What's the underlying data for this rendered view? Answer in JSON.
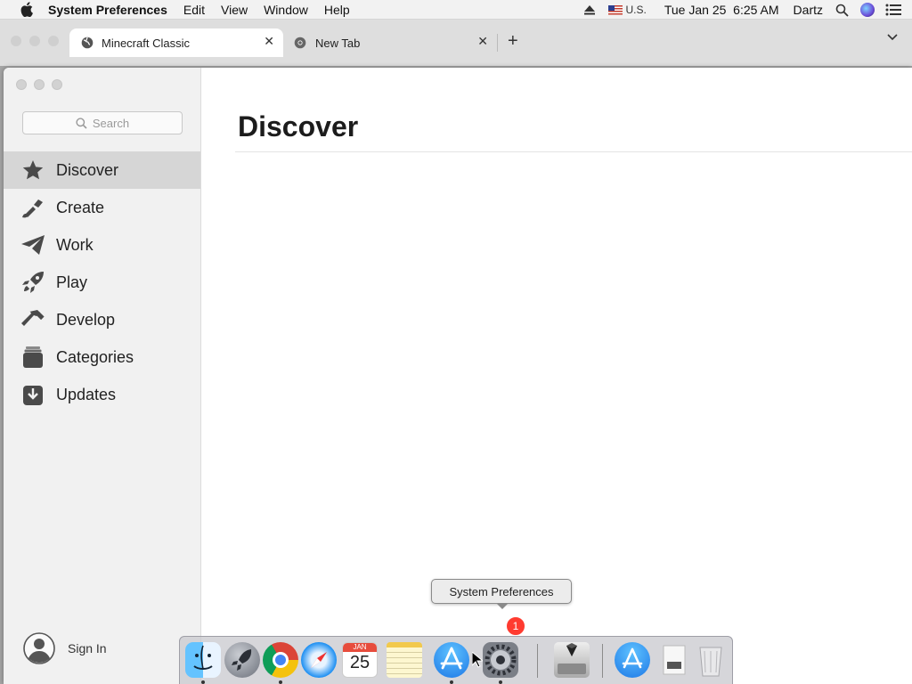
{
  "menubar": {
    "app_name": "System Preferences",
    "items": [
      "Edit",
      "View",
      "Window",
      "Help"
    ],
    "input_source": "U.S.",
    "datetime": "Tue Jan 25  6:25 AM",
    "user": "Dartz"
  },
  "browser": {
    "tabs": [
      {
        "title": "Minecraft Classic"
      },
      {
        "title": "New Tab"
      }
    ]
  },
  "sidebar": {
    "search_placeholder": "Search",
    "items": [
      {
        "label": "Discover",
        "icon": "star-icon"
      },
      {
        "label": "Create",
        "icon": "brush-icon"
      },
      {
        "label": "Work",
        "icon": "paper-plane-icon"
      },
      {
        "label": "Play",
        "icon": "rocket-icon"
      },
      {
        "label": "Develop",
        "icon": "hammer-icon"
      },
      {
        "label": "Categories",
        "icon": "stack-icon"
      },
      {
        "label": "Updates",
        "icon": "download-icon"
      }
    ],
    "sign_in": "Sign In"
  },
  "main": {
    "title": "Discover"
  },
  "tooltip": {
    "text": "System Preferences"
  },
  "dock": {
    "badge": "1",
    "calendar": {
      "month": "JAN",
      "day": "25"
    }
  },
  "colors": {
    "accent_blue": "#1e8cf3",
    "badge_red": "#ff3b30",
    "selection_gray": "#d6d6d6"
  }
}
